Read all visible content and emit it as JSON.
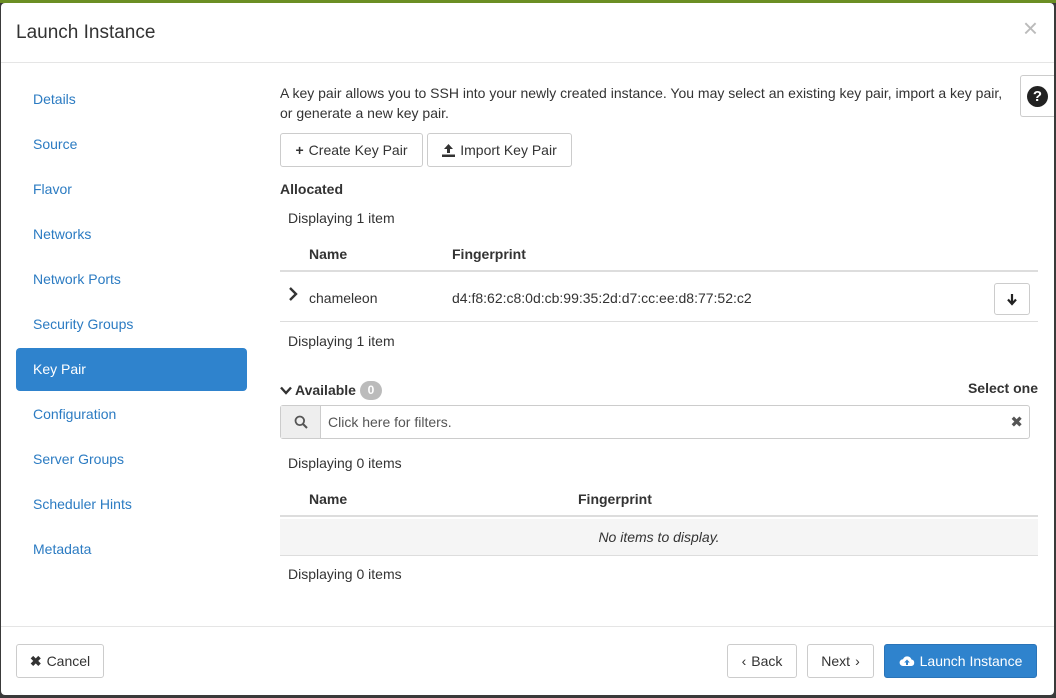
{
  "modal": {
    "title": "Launch Instance",
    "close_glyph": "×"
  },
  "sidebar": {
    "items": [
      {
        "label": "Details"
      },
      {
        "label": "Source"
      },
      {
        "label": "Flavor"
      },
      {
        "label": "Networks"
      },
      {
        "label": "Network Ports"
      },
      {
        "label": "Security Groups"
      },
      {
        "label": "Key Pair",
        "active": true
      },
      {
        "label": "Configuration"
      },
      {
        "label": "Server Groups"
      },
      {
        "label": "Scheduler Hints"
      },
      {
        "label": "Metadata"
      }
    ]
  },
  "content": {
    "description": "A key pair allows you to SSH into your newly created instance. You may select an existing key pair, import a key pair, or generate a new key pair.",
    "help_glyph": "?",
    "create_button": "Create Key Pair",
    "import_button": "Import Key Pair",
    "allocated": {
      "label": "Allocated",
      "display_top": "Displaying 1 item",
      "display_bottom": "Displaying 1 item",
      "columns": [
        "Name",
        "Fingerprint"
      ],
      "rows": [
        {
          "name": "chameleon",
          "fingerprint": "d4:f8:62:c8:0d:cb:99:35:2d:d7:cc:ee:d8:77:52:c2"
        }
      ]
    },
    "available": {
      "label": "Available",
      "count": "0",
      "select_one": "Select one",
      "filter_placeholder": "Click here for filters.",
      "display_top": "Displaying 0 items",
      "display_bottom": "Displaying 0 items",
      "columns": [
        "Name",
        "Fingerprint"
      ],
      "empty_text": "No items to display."
    }
  },
  "footer": {
    "cancel": "Cancel",
    "back": "Back",
    "next": "Next",
    "launch": "Launch Instance"
  },
  "colors": {
    "accent": "#2f83cd",
    "link": "#2b7bc2"
  }
}
